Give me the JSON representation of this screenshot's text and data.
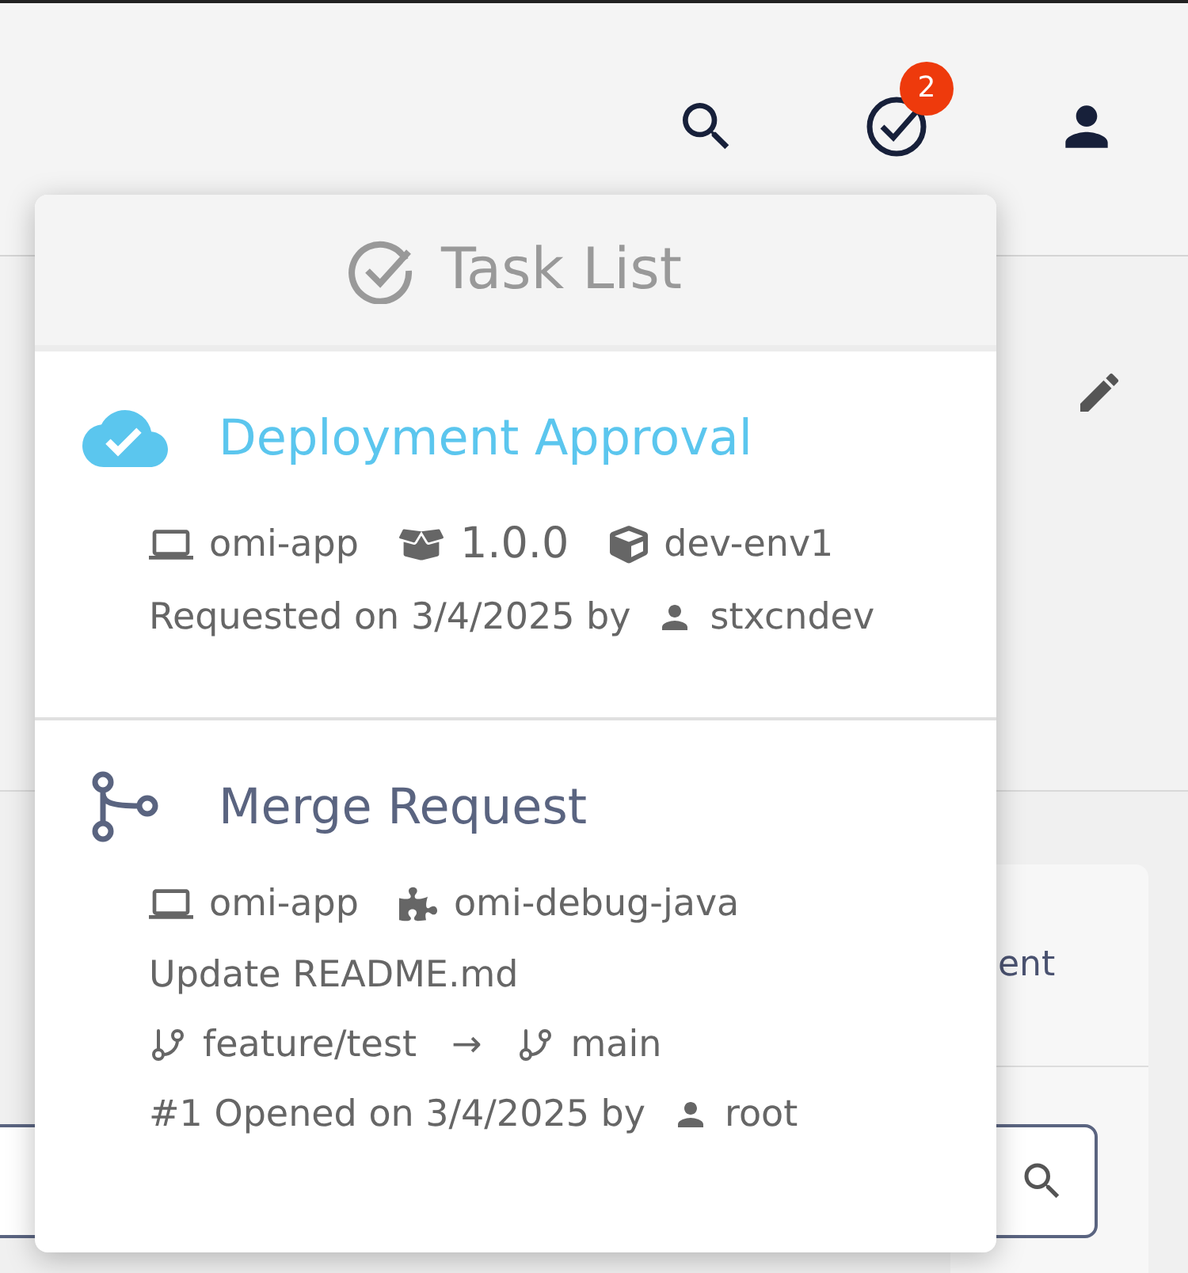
{
  "header": {
    "notification_badge": "2"
  },
  "background": {
    "card_text": "ent"
  },
  "task_list": {
    "title": "Task List",
    "tasks": [
      {
        "kind": "deployment",
        "title": "Deployment Approval",
        "meta": [
          {
            "kind": "app",
            "text": "omi-app"
          },
          {
            "kind": "version",
            "text": "1.0.0"
          },
          {
            "kind": "environment",
            "text": "dev-env1"
          }
        ],
        "byline": {
          "text": "Requested on 3/4/2025 by",
          "user": "stxcndev"
        }
      },
      {
        "kind": "merge",
        "title": "Merge Request",
        "meta": [
          {
            "kind": "app",
            "text": "omi-app"
          },
          {
            "kind": "project",
            "text": "omi-debug-java"
          }
        ],
        "description": "Update README.md",
        "branches": {
          "source": "feature/test",
          "arrow": "→",
          "target": "main"
        },
        "byline": {
          "text": "#1 Opened on 3/4/2025 by",
          "user": "root"
        }
      }
    ]
  }
}
